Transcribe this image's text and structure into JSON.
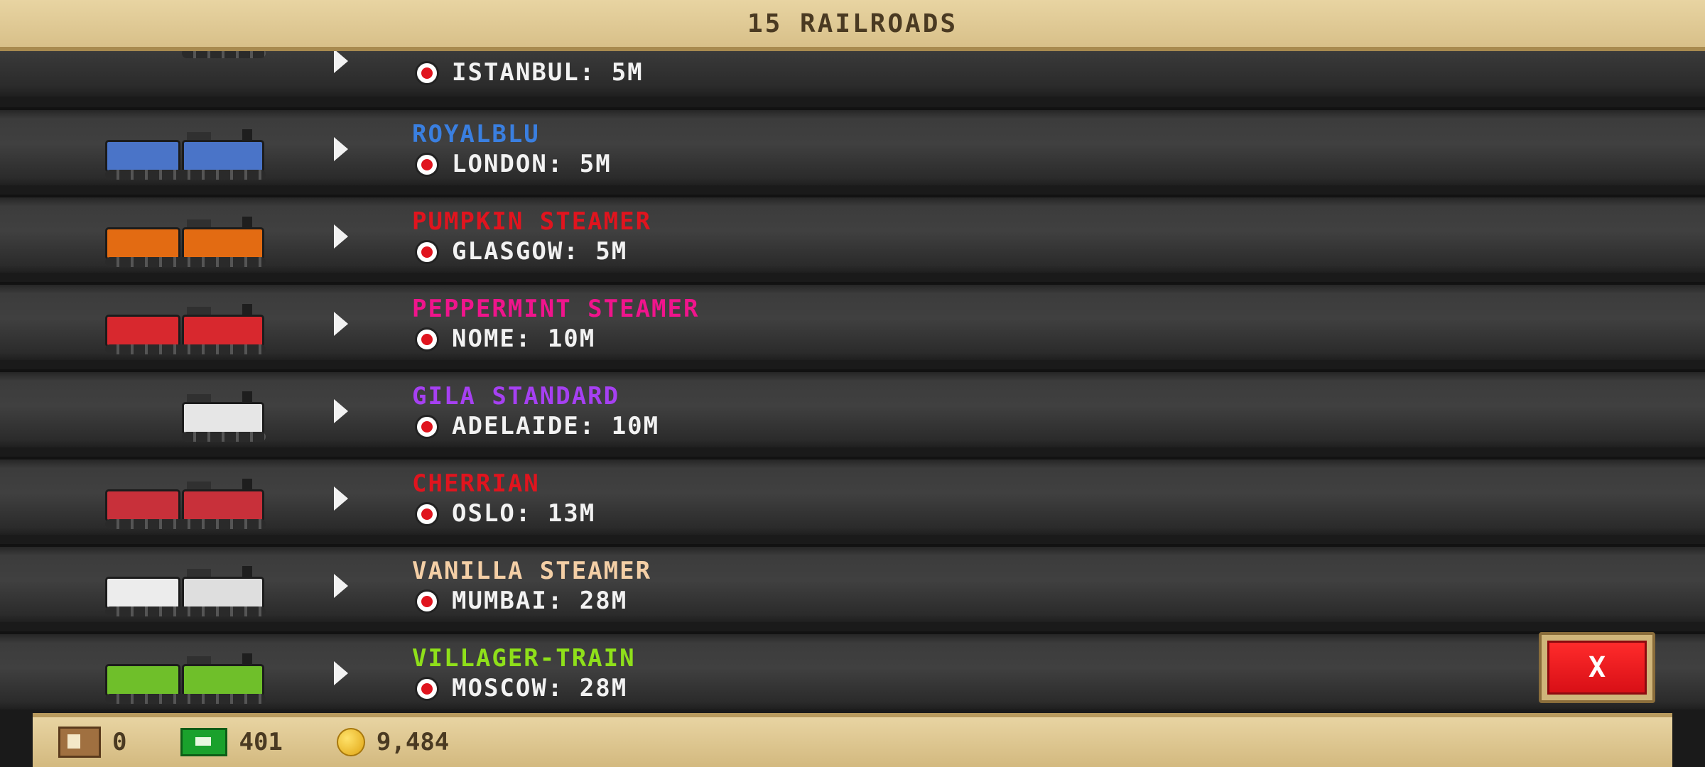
{
  "header": {
    "title": "15 RAILROADS"
  },
  "railroads": [
    {
      "name": "",
      "destination": "ISTANBUL: 5M",
      "color": "#3a66c4"
    },
    {
      "name": "ROYALBLU",
      "destination": "LONDON: 5M",
      "color": "#3a7fe0",
      "car": "#4a74c8",
      "loco": "#4a74c8"
    },
    {
      "name": "PUMPKIN STEAMER",
      "destination": "GLASGOW: 5M",
      "color": "#e0141e",
      "car": "#e36b12",
      "loco": "#e36b12"
    },
    {
      "name": "PEPPERMINT STEAMER",
      "destination": "NOME: 10M",
      "color": "#f0148c",
      "car": "#d8282e",
      "loco": "#d8282e"
    },
    {
      "name": "GILA STANDARD",
      "destination": "ADELAIDE: 10M",
      "color": "#a640f2",
      "car": "",
      "loco": "#e6e6e6"
    },
    {
      "name": "CHERRIAN",
      "destination": "OSLO: 13M",
      "color": "#e0141e",
      "car": "#c8303a",
      "loco": "#c8303a"
    },
    {
      "name": "VANILLA STEAMER",
      "destination": "MUMBAI: 28M",
      "color": "#f4cfa6",
      "car": "#ececec",
      "loco": "#dedede"
    },
    {
      "name": "VILLAGER-TRAIN",
      "destination": "MOSCOW: 28M",
      "color": "#8fe01a",
      "car": "#6fbf2a",
      "loco": "#6fbf2a"
    }
  ],
  "close_button": {
    "label": "X"
  },
  "footer": {
    "crates": "0",
    "cash": "401",
    "coins": "9,484"
  }
}
